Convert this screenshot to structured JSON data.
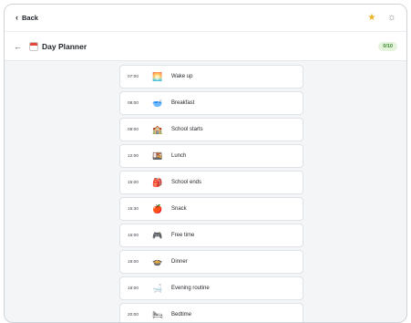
{
  "topbar": {
    "back_label": "Back",
    "star_icon": "star-icon",
    "theme_icon": "sun-icon"
  },
  "header": {
    "title": "Day Planner",
    "progress": "0/10",
    "title_icon": "calendar-icon"
  },
  "colors": {
    "accent_green": "#3b8a2e",
    "badge_bg": "#e4f3dc",
    "star": "#e8b21a"
  },
  "schedule": [
    {
      "time": "07:00",
      "icon": "sunrise-icon",
      "glyph": "🌅",
      "label": "Wake up"
    },
    {
      "time": "08:00",
      "icon": "bowl-icon",
      "glyph": "🥣",
      "label": "Breakfast"
    },
    {
      "time": "09:00",
      "icon": "school-icon",
      "glyph": "🏫",
      "label": "School starts"
    },
    {
      "time": "12:00",
      "icon": "lunchbox-icon",
      "glyph": "🍱",
      "label": "Lunch"
    },
    {
      "time": "15:00",
      "icon": "backpack-icon",
      "glyph": "🎒",
      "label": "School ends"
    },
    {
      "time": "15:30",
      "icon": "apple-icon",
      "glyph": "🍎",
      "label": "Snack"
    },
    {
      "time": "16:00",
      "icon": "gamepad-icon",
      "glyph": "🎮",
      "label": "Free time"
    },
    {
      "time": "18:00",
      "icon": "dinner-icon",
      "glyph": "🍲",
      "label": "Dinner"
    },
    {
      "time": "19:00",
      "icon": "bathtub-icon",
      "glyph": "🛁",
      "label": "Evening routine"
    },
    {
      "time": "20:00",
      "icon": "bed-icon",
      "glyph": "🛏",
      "label": "Bedtime"
    }
  ]
}
